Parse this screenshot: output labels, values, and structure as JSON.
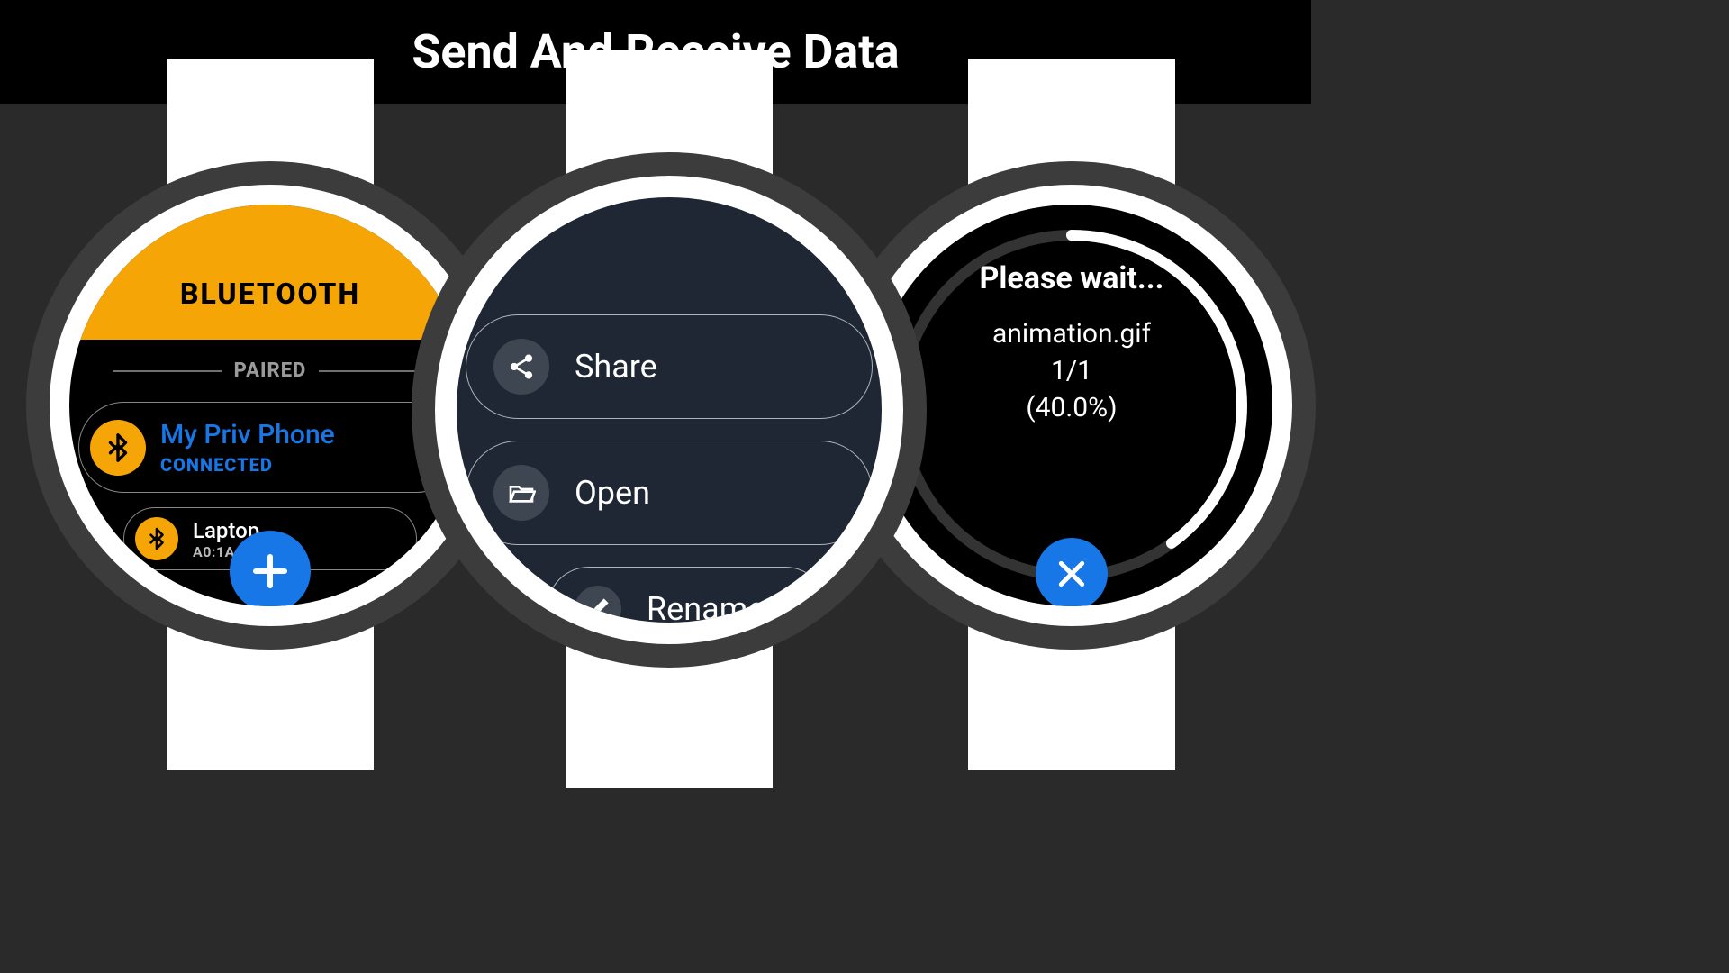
{
  "title": "Send And Receive Data",
  "watch1": {
    "header": "BLUETOOTH",
    "paired_label": "PAIRED",
    "devices": [
      {
        "name": "My Priv Phone",
        "status": "CONNECTED"
      },
      {
        "name": "Laptop",
        "mac": "A0:1A:12"
      }
    ],
    "icons": {
      "bluetooth": "bluetooth-icon",
      "add": "plus-icon"
    }
  },
  "watch2": {
    "actions": [
      {
        "icon": "share-icon",
        "label": "Share"
      },
      {
        "icon": "folder-icon",
        "label": "Open"
      },
      {
        "icon": "pencil-icon",
        "label": "Rename"
      }
    ]
  },
  "watch3": {
    "wait_text": "Please wait...",
    "file": "animation.gif",
    "index": "1/1",
    "percent": "(40.0%)",
    "progress_value": 40.0,
    "icons": {
      "cancel": "close-icon"
    }
  },
  "colors": {
    "accent_orange": "#f5a506",
    "accent_blue": "#1777e6",
    "watch2_bg": "#1e2733"
  }
}
